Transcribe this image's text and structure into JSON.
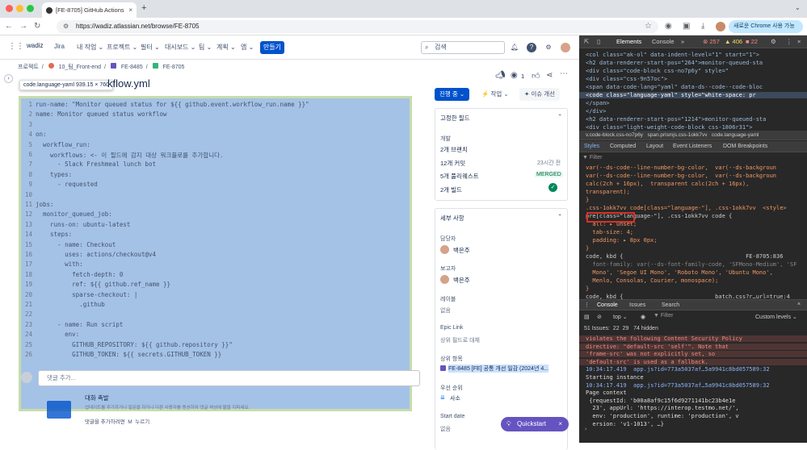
{
  "browser": {
    "tab_title": "[FE-8705] GitHub Actions - F",
    "url": "https://wadiz.atlassian.net/browse/FE-8705",
    "chrome_btn": "새로운 Chrome 사용 가능"
  },
  "jira": {
    "logo": "wadiz",
    "product": "Jira",
    "nav": [
      "내 작업",
      "프로젝트",
      "필터",
      "대시보드",
      "팀",
      "계획",
      "앱"
    ],
    "create": "만들기",
    "search": "검색"
  },
  "breadcrumb": [
    "프로젝트",
    "10_팀_Front-end",
    "FE-8485",
    "FE-8705"
  ],
  "tooltip": "code.language-yaml  939.15 × 760",
  "title": "kflow.yml",
  "code_lines": [
    "run-name: \"Monitor queued status for ${{ github.event.workflow_run.name }}\"",
    "name: Monitor queued status workflow",
    "",
    "on:",
    "  workflow_run:",
    "    workflows: <- 이 필드에 감지 대상 워크플로를 추가합니다.",
    "      - Slack Freshmeal lunch bot",
    "    types:",
    "      - requested",
    "",
    "jobs:",
    "  monitor_queued_job:",
    "    runs-on: ubuntu-latest",
    "    steps:",
    "      - name: Checkout",
    "        uses: actions/checkout@v4",
    "        with:",
    "          fetch-depth: 0",
    "          ref: ${{ github.ref_name }}",
    "          sparse-checkout: |",
    "            .github",
    "",
    "      - name: Run script",
    "        env:",
    "          GITHUB_REPOSITORY: ${{ github.repository }}\"",
    "          GITHUB_TOKEN: ${{ secrets.GITHUB_TOKEN }}"
  ],
  "comment": {
    "placeholder": "댓글 추가...",
    "tip_title": "대화 촉발",
    "tip_body": "업데이트를 추가하거나 질문을 하거나 다른 사용자를 멘션하여 댓글 섹션에 불을 지피세요.",
    "hint": "댓글을 추가하려면  M  누르기"
  },
  "actions": {
    "status": "진행 중",
    "watch_count": "1",
    "action": "작업",
    "improve": "이슈 개선"
  },
  "pinned": {
    "title": "고정한 필드",
    "dev_label": "개발",
    "items": [
      {
        "label": "2개 브랜치",
        "meta": ""
      },
      {
        "label": "12개 커밋",
        "meta": "23시간 전"
      },
      {
        "label": "5개 풀리퀘스트",
        "meta": "MERGED"
      },
      {
        "label": "2개 빌드",
        "meta": ""
      }
    ]
  },
  "details": {
    "title": "세부 사항",
    "assignee_label": "담당자",
    "assignee": "백은주",
    "reporter_label": "보고자",
    "reporter": "백은주",
    "labels_label": "레이블",
    "labels_value": "없음",
    "epic_label": "Epic Link",
    "epic_value": "상위 필드로 대체",
    "parent_label": "상위 항목",
    "parent_value": "FE-8485 [FE] 공통 개선 일감 (2024년 4...",
    "priority_label": "우선 순위",
    "priority_value": "사소",
    "start_label": "Start date",
    "start_value": "없음"
  },
  "quickstart": "Quickstart",
  "devtools": {
    "tabs": [
      "Elements",
      "Console"
    ],
    "counts": {
      "errors": "257",
      "warnings": "406",
      "issues": "22"
    },
    "dom": [
      "<col class=\"ak-ol\" data-indent-level=\"1\" start=\"1\">",
      "<h2 data-renderer-start-pos=\"264\">monitor-queued-sta",
      "<div class=\"code-block css-no7p6y\" style=\"",
      "<div class=\"css-9n57oc\">",
      "<span data-code-lang=\"yaml\" data-ds--code--code-bloc",
      "<code class=\"language-yaml\" style=\"white-space: pr",
      "</span>",
      "</div>",
      "<h2 data-renderer-start-pos=\"1214\">monitor-queued-sta",
      "<div class=\"light-weight-code-block css-1806r31\">"
    ],
    "crumbs": "v.code-block.css-no7p6y   span.prismjs.css-1okk7vv   code.language-yaml",
    "style_tabs": [
      "Styles",
      "Computed",
      "Layout",
      "Event Listeners",
      "DOM Breakpoints"
    ],
    "filter": "Filter",
    "rules": [
      "var(--ds-code--line-number-bg-color,  var(--ds-backgroun",
      "var(--ds-code--line-number-bg-color,  var(--ds-backgroun",
      "calc(2ch + 16px),  transparent calc(2ch + 16px),",
      "transparent);",
      "}",
      ".css-1okk7vv code[class=\"language-\"], .css-1okk7vv  <style>",
      "pre[class=\"language-\"], .css-1okk7vv code {",
      "  all: ▸ unset;",
      "  tab-size: 4;",
      "  padding: ▸ 8px 0px;",
      "}",
      "code, kbd {                                    FE-8705:836",
      "  font-family: var(--ds-font-family-code, 'SFMono-Medium', 'SF",
      "  Mono', 'Segoe UI Mono', 'Roboto Mono', 'Ubuntu Mono',",
      "  Menlo, Consolas, Courier, monospace);",
      "}",
      "code, kbd {                           batch.css?r…url=true:4",
      "  font-family: monospace;"
    ],
    "console_tabs": [
      "Console",
      "Issues",
      "Search"
    ],
    "console_top": "top",
    "console_levels": "Custom levels",
    "console_issues": "51 Issues:  22  29   74 hidden",
    "console": [
      "violates the following Content Security Policy",
      "directive: \"default-src 'self'\". Note that",
      "'frame-src' was not explicitly set, so",
      "'default-src' is used as a fallback.",
      "10:34:17.419  app.js?id=773a5037af…5a9941c8bd057589:32",
      "Starting instance",
      "10:34:17.419  app.js?id=773a5037af…5a9941c8bd057589:32",
      "Page context",
      " {requestId: 'b00a8af9c15f6d9271141bc23b4e1e",
      "  23', appUrl: 'https://interop.testmo.net/',",
      "  env: 'production', runtime: 'production', v",
      "  ersion: 'v1-1013', …}"
    ]
  },
  "colors": {
    "code_bg": "#a4c2e6",
    "devtools_bg": "#282828",
    "primary": "#0052cc",
    "highlight": "#d93025"
  }
}
